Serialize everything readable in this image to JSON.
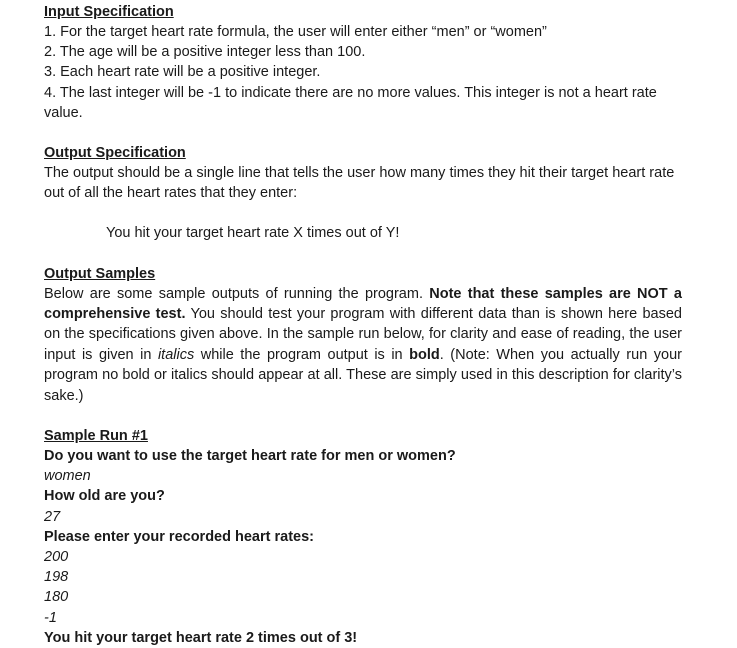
{
  "document": {
    "input_spec": {
      "heading": "Input Specification",
      "items": [
        "1. For the target heart rate formula, the user will enter either “men” or “women”",
        "2. The age will be a positive integer less than 100.",
        "3. Each heart rate will be a positive integer.",
        "4. The last integer will be -1 to indicate there are no more values.  This integer is not a heart rate value."
      ]
    },
    "output_spec": {
      "heading": "Output Specification",
      "body": "The output should be a single line that tells the user how many times they hit their target heart rate out of all the heart rates that they enter:",
      "example_line": "You hit your target heart rate X times out of Y!"
    },
    "output_samples": {
      "heading": "Output Samples",
      "intro_part1": "Below are some sample outputs of running the program. ",
      "intro_bold1": "Note that these samples are NOT a comprehensive test.",
      "intro_part2": " You should test your program with different data than is shown here based on the specifications given above. In the sample run below, for clarity and ease of reading, the user input is given in ",
      "intro_italic": "italics",
      "intro_part3": " while the program output is in ",
      "intro_bold2": "bold",
      "intro_part4": ". (Note: When you actually run your program no bold or italics should appear at all. These are simply used in this description for clarity’s sake.)"
    },
    "sample_run": {
      "heading": "Sample Run #1",
      "lines": [
        {
          "kind": "prompt",
          "text": "Do you want to use the target heart rate for men or women?"
        },
        {
          "kind": "input",
          "text": "women"
        },
        {
          "kind": "prompt",
          "text": "How old are you?"
        },
        {
          "kind": "input",
          "text": "27"
        },
        {
          "kind": "prompt",
          "text": "Please enter your recorded heart rates:"
        },
        {
          "kind": "input",
          "text": "200"
        },
        {
          "kind": "input",
          "text": "198"
        },
        {
          "kind": "input",
          "text": "180"
        },
        {
          "kind": "input",
          "text": "-1"
        },
        {
          "kind": "output",
          "text": "You hit your target heart rate 2 times out of 3!"
        }
      ]
    }
  }
}
